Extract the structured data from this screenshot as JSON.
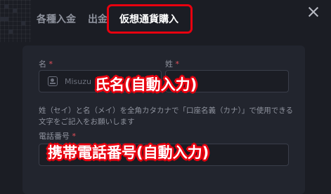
{
  "tabs": [
    {
      "label": "各種入金",
      "active": false
    },
    {
      "label": "出金",
      "active": false
    },
    {
      "label": "仮想通貨購入",
      "active": true
    }
  ],
  "form": {
    "last_name_label": "名",
    "first_name_label": "姓",
    "required_mark": "*",
    "last_name_value": "Misuzu",
    "hint": "姓（セイ）と名（メイ）を全角カタカナで「口座名義（カナ）」で使用できる文字をご記入をお願いします",
    "phone_label": "電話番号"
  },
  "annotations": {
    "name_callout": "氏名(自動入力)",
    "phone_callout": "携帯電話番号(自動入力)",
    "highlight_color": "#e8000f"
  },
  "icons": {
    "close": "close-icon",
    "id_card": "id-card-icon"
  }
}
